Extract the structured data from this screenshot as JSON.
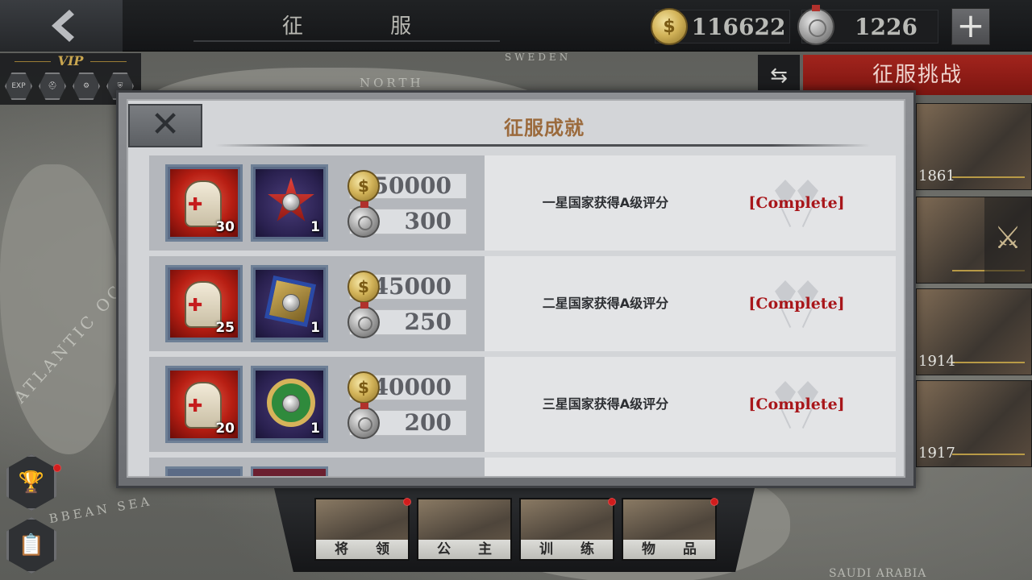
{
  "header": {
    "title": "征 服",
    "gold_amount": "116622",
    "medal_amount": "1226",
    "gold_icon": "gold-coin-icon",
    "medal_icon": "silver-medal-icon"
  },
  "vip": {
    "label": "VIP",
    "icons": [
      "EXP",
      "",
      "",
      ""
    ]
  },
  "map": {
    "labels": [
      "SWEDEN",
      "NORTH",
      "ATLANTIC OC",
      "BBEAN SEA",
      "SAUDI ARABIA"
    ]
  },
  "right_panel": {
    "challenge_label": "征服挑战",
    "eras": [
      "1861",
      "",
      "1914",
      "1917"
    ]
  },
  "modal": {
    "title": "征服成就",
    "rows": [
      {
        "kit_qty": "30",
        "badge_qty": "1",
        "gold": "50000",
        "medal": "300",
        "description": "一星国家获得A级评分",
        "status": "[Complete]"
      },
      {
        "kit_qty": "25",
        "badge_qty": "1",
        "gold": "45000",
        "medal": "250",
        "description": "二星国家获得A级评分",
        "status": "[Complete]"
      },
      {
        "kit_qty": "20",
        "badge_qty": "1",
        "gold": "40000",
        "medal": "200",
        "description": "三星国家获得A级评分",
        "status": "[Complete]"
      }
    ]
  },
  "bottom_tabs": [
    "将 领",
    "公 主",
    "训 练",
    "物 品"
  ],
  "colors": {
    "accent_red": "#a2241d",
    "title_brown": "#9b6a3c",
    "complete_red": "#a8161a"
  }
}
